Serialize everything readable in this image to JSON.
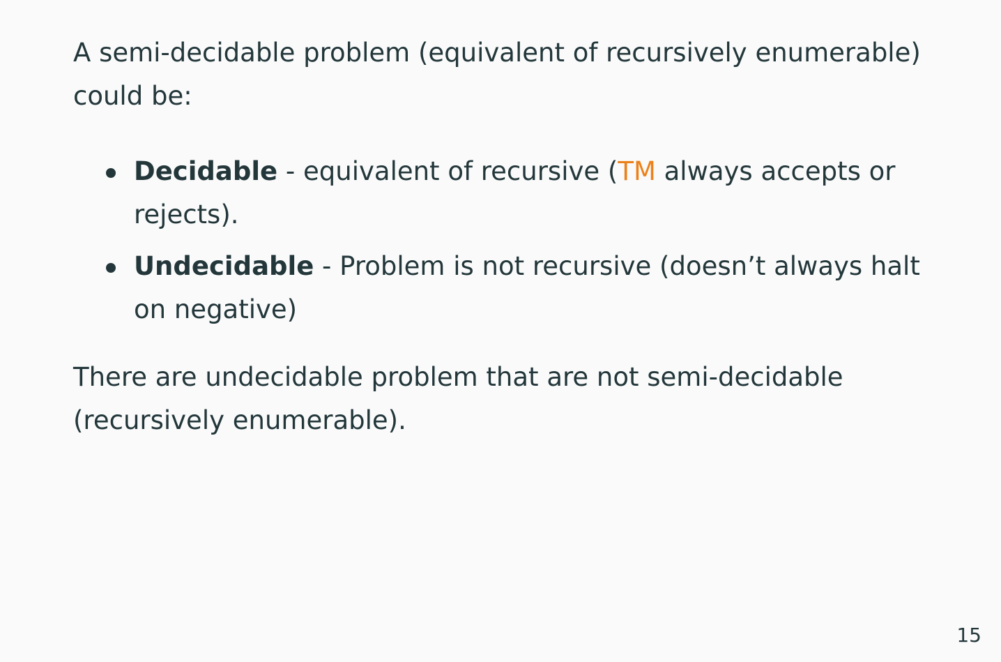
{
  "intro": {
    "text": "A semi-decidable problem (equivalent of recursively enumerable) could be:"
  },
  "bullets": [
    {
      "term": "Decidable",
      "before": " - equivalent of recursive (",
      "highlight": "TM",
      "after": " always accepts or rejects)."
    },
    {
      "term": "Undecidable",
      "rest": " - Problem is not recursive (doesn’t always halt on negative)"
    }
  ],
  "outro": {
    "text": "There are undecidable problem that are not semi-decidable (recursively enumerable)."
  },
  "page_number": "15",
  "colors": {
    "text": "#23373b",
    "accent": "#eb811b",
    "background": "#fafafa"
  }
}
